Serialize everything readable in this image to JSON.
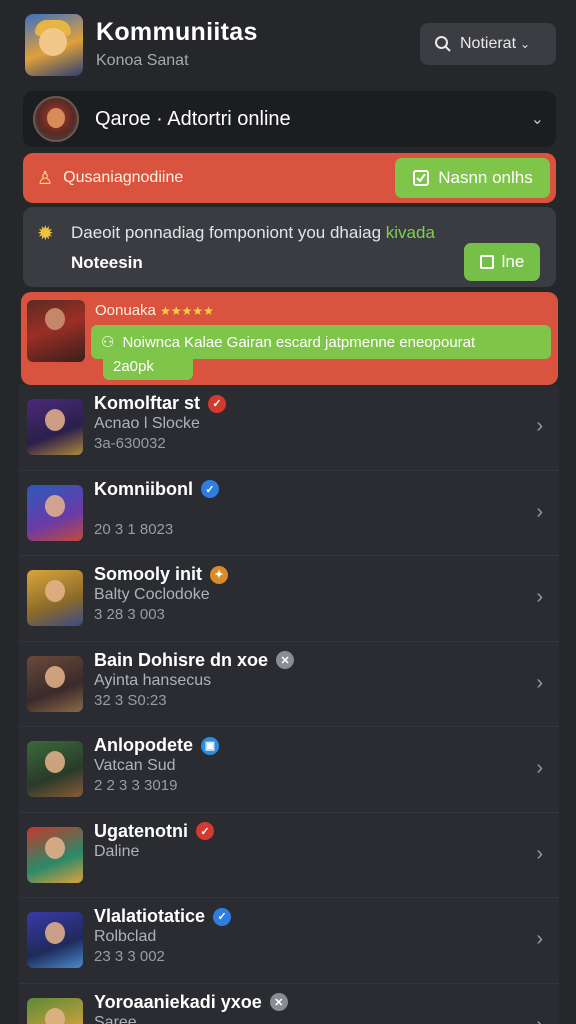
{
  "header": {
    "title": "Kommuniitas",
    "subtitle": "Konoa Sanat",
    "notif_label": "Notierat"
  },
  "game_select": {
    "label": "Qaroe · Adtortri online"
  },
  "banner": {
    "text": "Qusaniagnodiine",
    "button": "Nasnn onlhs"
  },
  "notice": {
    "line_prefix": "Daeoit ponnadiag fomponiont you dhaiag",
    "line_highlight": "kivada",
    "strong": "Noteesin",
    "button": "lne"
  },
  "featured": {
    "name": "Oonuaka",
    "stars": "★★★★★",
    "pill": "Noiwnca Kalae Gairan escard jatpmenne eneopourat",
    "count": "2a0pk"
  },
  "list": [
    {
      "name": "Komolftar st",
      "sub": "Acnao l Slocke",
      "meta": "3a-630032",
      "badge": "red-check",
      "theme": "purple"
    },
    {
      "name": "Komniibonl",
      "sub": "",
      "meta": "20 3 1 8023",
      "badge": "blue-check",
      "theme": "blue"
    },
    {
      "name": "Somooly init",
      "sub": "Balty Coclodoke",
      "meta": "3 28 3 003",
      "badge": "orange-tag",
      "theme": "gold"
    },
    {
      "name": "Bain Dohisre dn xoe",
      "sub": "Ayinta hansecus",
      "meta": "32 3 S0:23",
      "badge": "grey-x",
      "theme": "brown"
    },
    {
      "name": "Anlopodete",
      "sub": "Vatcan Sud",
      "meta": "2 2 3 3 3019",
      "badge": "blue-tag",
      "theme": "green"
    },
    {
      "name": "Ugatenotni",
      "sub": "Daline",
      "meta": "",
      "badge": "red-check",
      "theme": "red"
    },
    {
      "name": "Vlalatiotatice",
      "sub": "Rolbclad",
      "meta": "23 3 3 002",
      "badge": "blue-check",
      "theme": "indigo"
    },
    {
      "name": "Yoroaaniekadi yxoe",
      "sub": "Saree",
      "meta": "",
      "badge": "grey-x",
      "theme": "olive"
    }
  ],
  "colors": {
    "bg": "#25272b",
    "accent_red": "#d9533f",
    "accent_green": "#7ec54a"
  }
}
